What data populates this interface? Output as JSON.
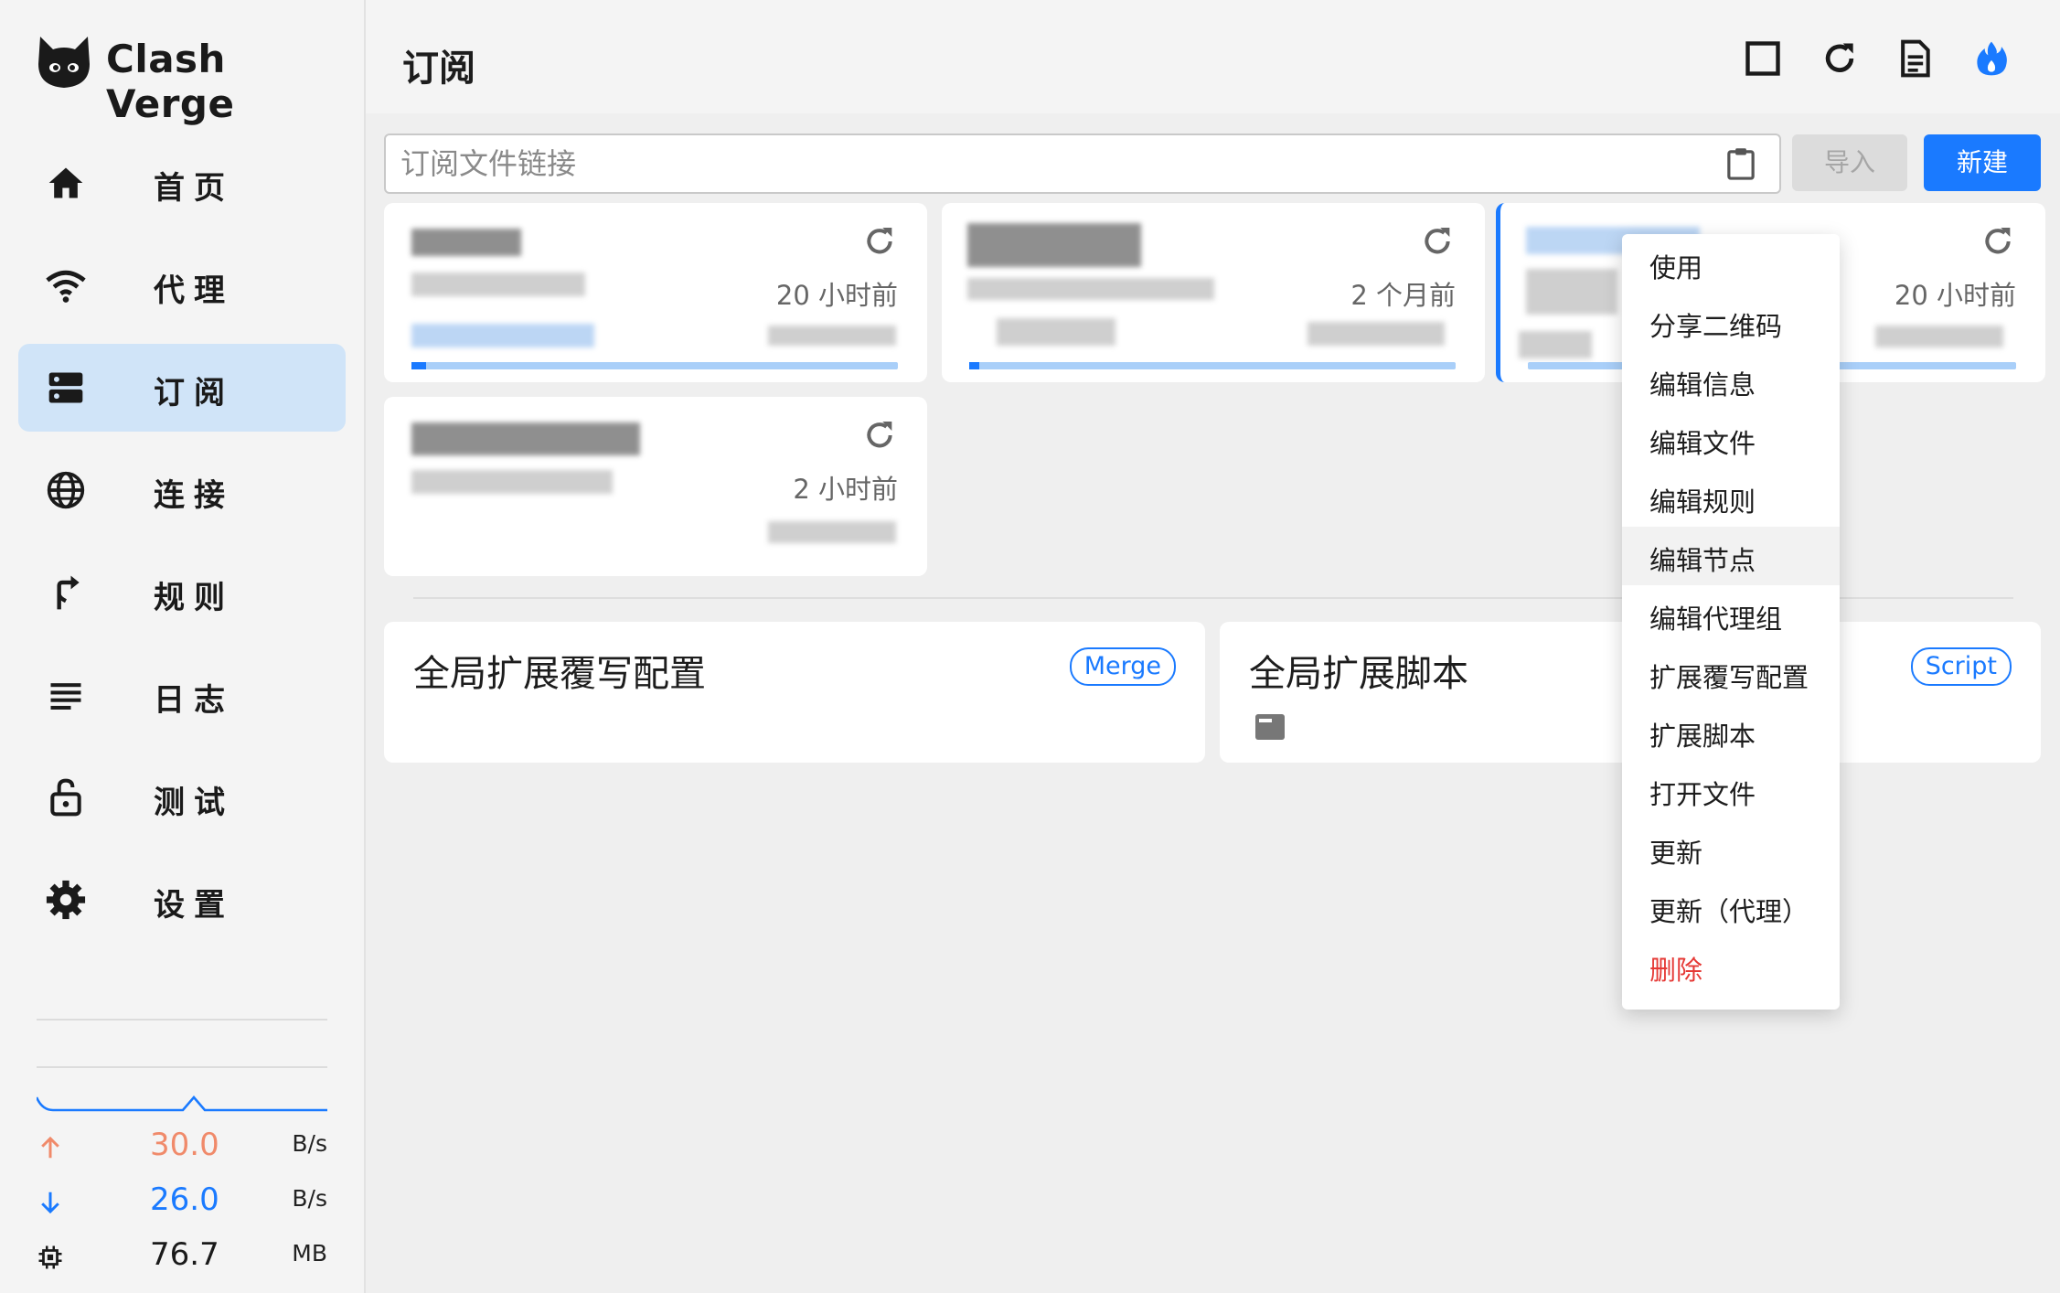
{
  "app": {
    "title": "Clash Verge"
  },
  "nav": [
    {
      "label": "首页",
      "icon": "home-icon"
    },
    {
      "label": "代理",
      "icon": "wifi-icon"
    },
    {
      "label": "订阅",
      "icon": "server-icon",
      "active": true
    },
    {
      "label": "连接",
      "icon": "globe-icon"
    },
    {
      "label": "规则",
      "icon": "fork-arrow-icon"
    },
    {
      "label": "日志",
      "icon": "list-lines-icon"
    },
    {
      "label": "测试",
      "icon": "lock-open-icon"
    },
    {
      "label": "设置",
      "icon": "gear-icon"
    }
  ],
  "traffic": {
    "up": {
      "value": "30.0",
      "unit": "B/s",
      "color": "#f08a6a"
    },
    "down": {
      "value": "26.0",
      "unit": "B/s",
      "color": "#1a7aff"
    },
    "memory": {
      "value": "76.7",
      "unit": "MB"
    }
  },
  "header": {
    "title": "订阅",
    "icons": [
      "square-icon",
      "refresh-icon",
      "document-icon",
      "flame-icon"
    ]
  },
  "subscribe": {
    "url_placeholder": "订阅文件链接",
    "url_value": "",
    "import_label": "导入",
    "new_label": "新建"
  },
  "profiles": [
    {
      "updated": "20 小时前",
      "usage": 0.03
    },
    {
      "updated": "2 个月前",
      "usage": 0.02
    },
    {
      "updated": "20 小时前",
      "usage": 0.0,
      "selected": true
    },
    {
      "updated": "2 小时前"
    }
  ],
  "extensions": [
    {
      "title": "全局扩展覆写配置",
      "tag": "Merge"
    },
    {
      "title": "全局扩展脚本",
      "tag": "Script"
    }
  ],
  "context_menu": {
    "items": [
      "使用",
      "分享二维码",
      "编辑信息",
      "编辑文件",
      "编辑规则",
      "编辑节点",
      "编辑代理组",
      "扩展覆写配置",
      "扩展脚本",
      "打开文件",
      "更新",
      "更新（代理）",
      "删除"
    ],
    "hover_index": 5,
    "danger_index": 12,
    "danger_color": "#e53935"
  },
  "colors": {
    "accent": "#1a7aff",
    "active_nav": "#d0e4f8"
  }
}
